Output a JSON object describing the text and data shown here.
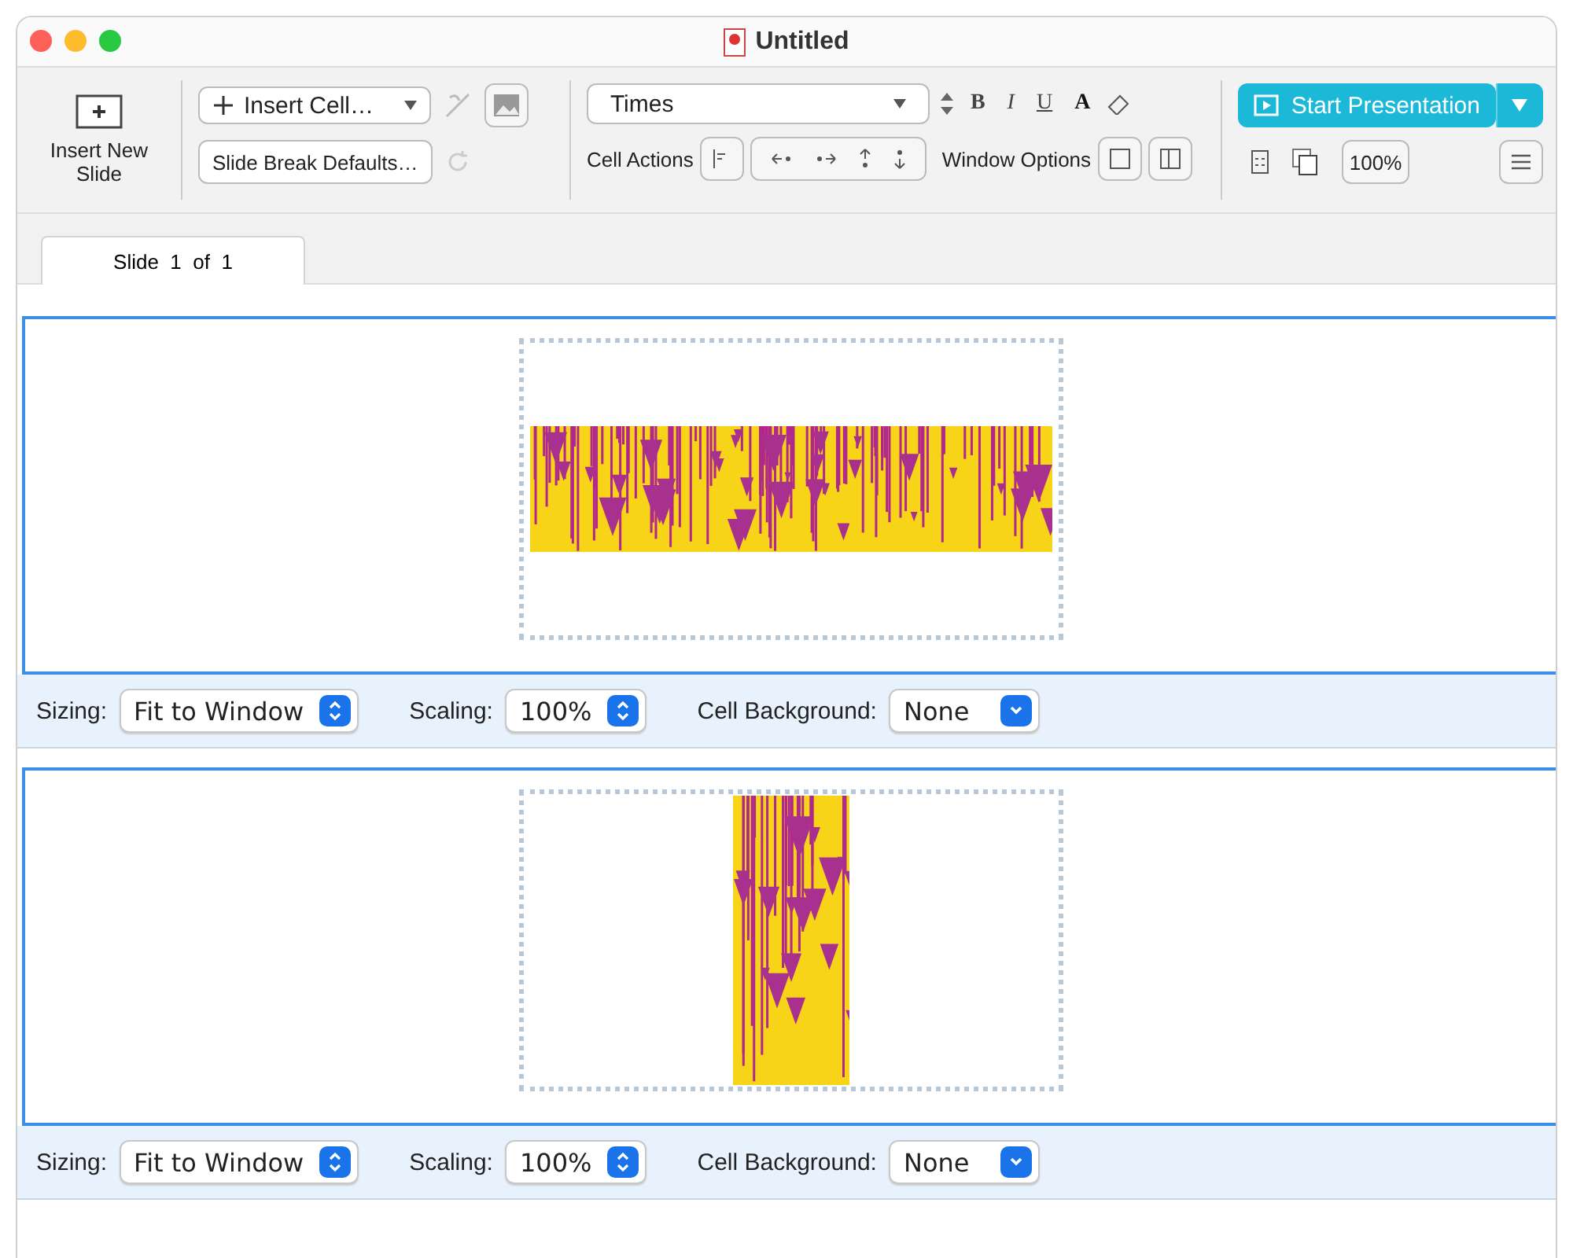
{
  "window": {
    "title": "Untitled"
  },
  "toolbar": {
    "insert_slide": "Insert New Slide",
    "insert_cell": "Insert Cell…",
    "slide_break_defaults": "Slide Break Defaults…",
    "font": "Times",
    "format_buttons": [
      "B",
      "I",
      "U",
      "A"
    ],
    "cell_actions": "Cell Actions",
    "window_options": "Window Options",
    "start_presentation": "Start Presentation",
    "zoom": "100%"
  },
  "tabs": [
    {
      "label": "Slide  1  of  1",
      "selected": true
    }
  ],
  "cells": [
    {
      "kind": "wide",
      "sizing_label": "Sizing:",
      "sizing": "Fit to Window",
      "scaling_label": "Scaling:",
      "scaling": "100%",
      "background_label": "Cell Background:",
      "background": "None"
    },
    {
      "kind": "tall",
      "sizing_label": "Sizing:",
      "sizing": "Fit to Window",
      "scaling_label": "Scaling:",
      "scaling": "100%",
      "background_label": "Cell Background:",
      "background": "None"
    }
  ]
}
